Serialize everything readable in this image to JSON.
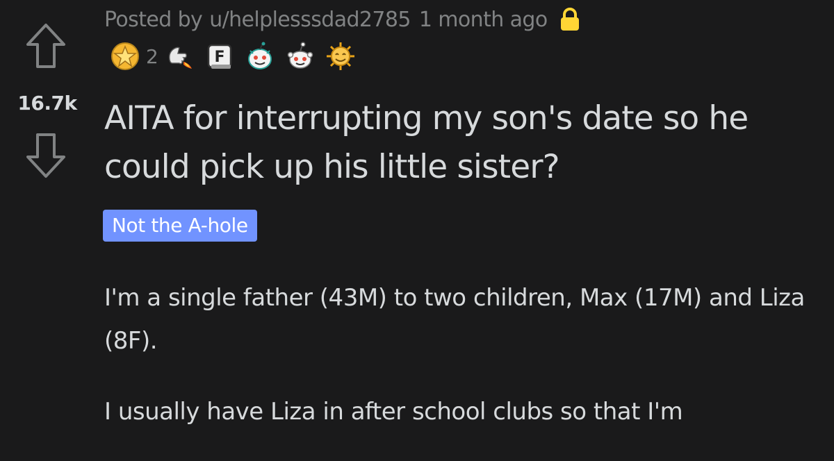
{
  "post": {
    "score": "16.7k",
    "meta": {
      "posted_by_label": "Posted by",
      "username": "u/helplesssdad2785",
      "time_ago": "1 month ago"
    },
    "awards": [
      {
        "name": "gold-star-award",
        "count": "2"
      },
      {
        "name": "rocket-like-award",
        "count": null
      },
      {
        "name": "press-f-award",
        "count": null
      },
      {
        "name": "wholesome-seal-award",
        "count": null
      },
      {
        "name": "snoo-award",
        "count": null
      },
      {
        "name": "sun-smile-award",
        "count": null
      }
    ],
    "title": "AITA for interrupting my son's date so he could pick up his little sister?",
    "flair": {
      "label": "Not the A-hole",
      "color": "#7193ff"
    },
    "body": [
      "I'm a single father (43M) to two children, Max (17M) and Liza (8F).",
      "I usually have Liza in after school clubs so that I'm"
    ]
  },
  "theme": {
    "background": "#1a1a1b",
    "text": "#d7dadc",
    "muted": "#818384",
    "lock": "#ffd635"
  }
}
